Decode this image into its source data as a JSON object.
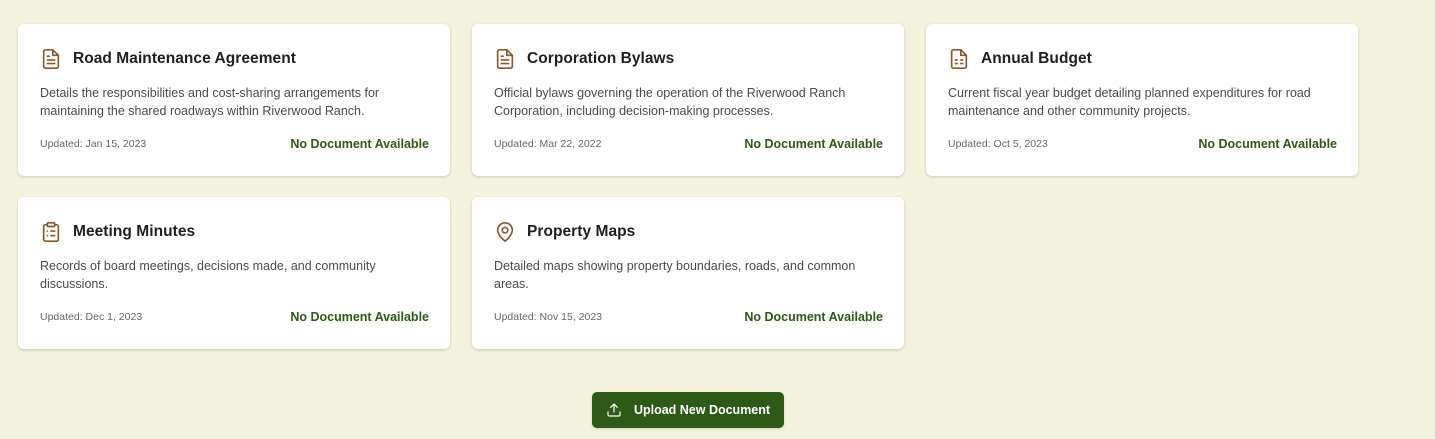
{
  "colors": {
    "background": "#f3f3dc",
    "accent": "#2d5a16",
    "icon": "#8b5a2b"
  },
  "documents": [
    {
      "title": "Road Maintenance Agreement",
      "icon": "file-text-icon",
      "description": "Details the responsibilities and cost-sharing arrangements for maintaining the shared roadways within Riverwood Ranch.",
      "updated": "Updated: Jan 15, 2023",
      "status": "No Document Available"
    },
    {
      "title": "Corporation Bylaws",
      "icon": "file-text-icon",
      "description": "Official bylaws governing the operation of the Riverwood Ranch Corporation, including decision-making processes.",
      "updated": "Updated: Mar 22, 2022",
      "status": "No Document Available"
    },
    {
      "title": "Annual Budget",
      "icon": "file-spreadsheet-icon",
      "description": "Current fiscal year budget detailing planned expenditures for road maintenance and other community projects.",
      "updated": "Updated: Oct 5, 2023",
      "status": "No Document Available"
    },
    {
      "title": "Meeting Minutes",
      "icon": "clipboard-list-icon",
      "description": "Records of board meetings, decisions made, and community discussions.",
      "updated": "Updated: Dec 1, 2023",
      "status": "No Document Available"
    },
    {
      "title": "Property Maps",
      "icon": "map-pin-icon",
      "description": "Detailed maps showing property boundaries, roads, and common areas.",
      "updated": "Updated: Nov 15, 2023",
      "status": "No Document Available"
    }
  ],
  "upload_button": {
    "label": "Upload New Document",
    "icon": "upload-icon"
  }
}
